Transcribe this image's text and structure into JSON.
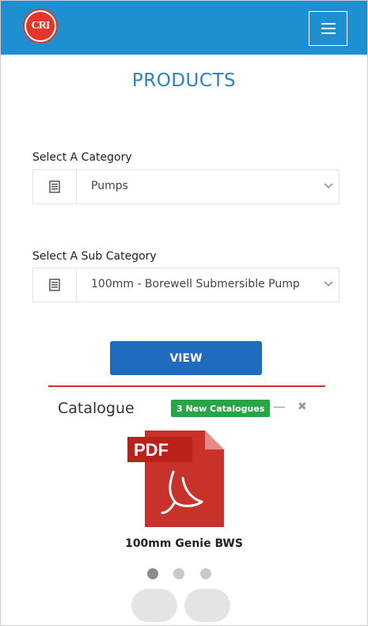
{
  "header": {
    "logo_text": "CRI",
    "colors": {
      "bar": "#1e8fd0",
      "logo_ring": "#d93a2b"
    },
    "menu_icon": "hamburger-icon"
  },
  "page": {
    "title": "PRODUCTS"
  },
  "form": {
    "category_label": "Select A Category",
    "category_value": "Pumps",
    "subcategory_label": "Select A Sub Category",
    "subcategory_value": "100mm - Borewell Submersible Pump",
    "select_icon": "list-icon",
    "view_button": "VIEW"
  },
  "catalogue": {
    "title": "Catalogue",
    "badge": "3 New Catalogues",
    "minimize_icon": "minus-icon",
    "close_icon": "close-icon",
    "file_type": "PDF",
    "file_name": "100mm Genie BWS",
    "carousel": {
      "total": 3,
      "active_index": 0
    },
    "colors": {
      "badge": "#27a547",
      "divider": "#d6322a",
      "pdf": "#c8322a"
    }
  },
  "colors": {
    "accent": "#2f7fc4",
    "button": "#1f6bbf"
  }
}
